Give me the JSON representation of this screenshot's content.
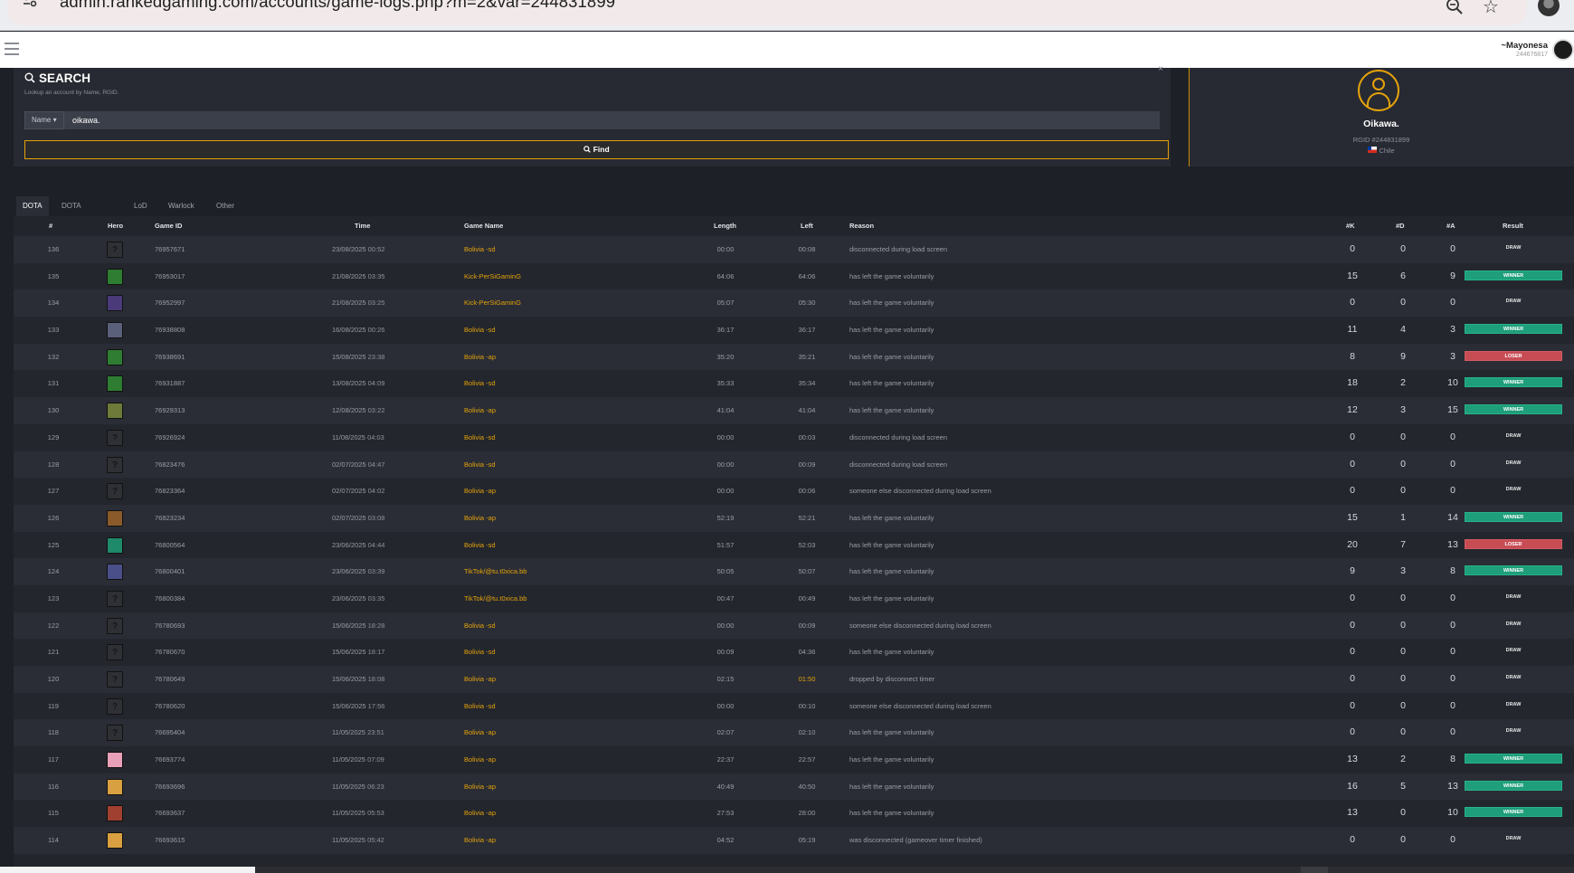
{
  "browser": {
    "url": "admin.rankedgaming.com/accounts/game-logs.php?m=2&var=244831899"
  },
  "header": {
    "user_name": "~Mayonesa",
    "user_id": "244676817"
  },
  "search": {
    "title": "SEARCH",
    "subtitle": "Lookup an account by Name, RGID.",
    "field_select": "Name ▾",
    "query": "oikawa.",
    "find_label": "Find"
  },
  "profile": {
    "name": "Oikawa.",
    "rgid": "RGID #244831899",
    "country": "Chile"
  },
  "tabs": [
    {
      "label": "DOTA",
      "active": true
    },
    {
      "label": "DOTA Dynamic",
      "active": false
    },
    {
      "label": "LoD",
      "active": false
    },
    {
      "label": "Warlock",
      "active": false
    },
    {
      "label": "Other",
      "active": false
    }
  ],
  "table": {
    "headers": {
      "num": "#",
      "hero": "Hero",
      "game_id": "Game ID",
      "time": "Time",
      "game_name": "Game Name",
      "length": "Length",
      "left": "Left",
      "reason": "Reason",
      "k": "#K",
      "d": "#D",
      "a": "#A",
      "result": "Result"
    },
    "rows": [
      {
        "num": "136",
        "hero": "unknown",
        "game_id": "76957671",
        "date": "23/08/2025",
        "clock": "00:52",
        "game_name": "Bolivia -sd",
        "length": "00:00",
        "left": "00:08",
        "reason": "disconnected during load screen",
        "k": "0",
        "d": "0",
        "a": "0",
        "result": "DRAW"
      },
      {
        "num": "135",
        "hero": "#2e7d32",
        "game_id": "76953017",
        "date": "21/08/2025",
        "clock": "03:35",
        "game_name": "Kick-PerSiGaminG",
        "length": "64:06",
        "left": "64:06",
        "reason": "has left the game voluntarily",
        "k": "15",
        "d": "6",
        "a": "9",
        "result": "WINNER"
      },
      {
        "num": "134",
        "hero": "#4a3a7a",
        "game_id": "76952997",
        "date": "21/08/2025",
        "clock": "03:25",
        "game_name": "Kick-PerSiGaminG",
        "length": "05:07",
        "left": "05:30",
        "reason": "has left the game voluntarily",
        "k": "0",
        "d": "0",
        "a": "0",
        "result": "DRAW"
      },
      {
        "num": "133",
        "hero": "#5a5f7a",
        "game_id": "76938808",
        "date": "16/08/2025",
        "clock": "00:26",
        "game_name": "Bolivia -sd",
        "length": "36:17",
        "left": "36:17",
        "reason": "has left the game voluntarily",
        "k": "11",
        "d": "4",
        "a": "3",
        "result": "WINNER"
      },
      {
        "num": "132",
        "hero": "#2e7d32",
        "game_id": "76938691",
        "date": "15/08/2025",
        "clock": "23:38",
        "game_name": "Bolivia -ap",
        "length": "35:20",
        "left": "35:21",
        "reason": "has left the game voluntarily",
        "k": "8",
        "d": "9",
        "a": "3",
        "result": "LOSER"
      },
      {
        "num": "131",
        "hero": "#2e7d32",
        "game_id": "76931887",
        "date": "13/08/2025",
        "clock": "04:09",
        "game_name": "Bolivia -sd",
        "length": "35:33",
        "left": "35:34",
        "reason": "has left the game voluntarily",
        "k": "18",
        "d": "2",
        "a": "10",
        "result": "WINNER"
      },
      {
        "num": "130",
        "hero": "#6d7a3a",
        "game_id": "76929313",
        "date": "12/08/2025",
        "clock": "03:22",
        "game_name": "Bolivia -ap",
        "length": "41:04",
        "left": "41:04",
        "reason": "has left the game voluntarily",
        "k": "12",
        "d": "3",
        "a": "15",
        "result": "WINNER"
      },
      {
        "num": "129",
        "hero": "unknown",
        "game_id": "76926924",
        "date": "11/08/2025",
        "clock": "04:03",
        "game_name": "Bolivia -sd",
        "length": "00:00",
        "left": "00:03",
        "reason": "disconnected during load screen",
        "k": "0",
        "d": "0",
        "a": "0",
        "result": "DRAW"
      },
      {
        "num": "128",
        "hero": "unknown",
        "game_id": "76823476",
        "date": "02/07/2025",
        "clock": "04:47",
        "game_name": "Bolivia -sd",
        "length": "00:00",
        "left": "00:09",
        "reason": "disconnected during load screen",
        "k": "0",
        "d": "0",
        "a": "0",
        "result": "DRAW"
      },
      {
        "num": "127",
        "hero": "unknown",
        "game_id": "76823364",
        "date": "02/07/2025",
        "clock": "04:02",
        "game_name": "Bolivia -ap",
        "length": "00:00",
        "left": "00:06",
        "reason": "someone else disconnected during load screen",
        "k": "0",
        "d": "0",
        "a": "0",
        "result": "DRAW"
      },
      {
        "num": "126",
        "hero": "#8a5a2a",
        "game_id": "76823234",
        "date": "02/07/2025",
        "clock": "03:08",
        "game_name": "Bolivia -ap",
        "length": "52:19",
        "left": "52:21",
        "reason": "has left the game voluntarily",
        "k": "15",
        "d": "1",
        "a": "14",
        "result": "WINNER"
      },
      {
        "num": "125",
        "hero": "#1f8a6a",
        "game_id": "76800564",
        "date": "23/06/2025",
        "clock": "04:44",
        "game_name": "Bolivia -sd",
        "length": "51:57",
        "left": "52:03",
        "reason": "has left the game voluntarily",
        "k": "20",
        "d": "7",
        "a": "13",
        "result": "LOSER"
      },
      {
        "num": "124",
        "hero": "#4a4f8a",
        "game_id": "76800401",
        "date": "23/06/2025",
        "clock": "03:39",
        "game_name": "TikTok/@tu.t0xica.bb",
        "length": "50:05",
        "left": "50:07",
        "reason": "has left the game voluntarily",
        "k": "9",
        "d": "3",
        "a": "8",
        "result": "WINNER"
      },
      {
        "num": "123",
        "hero": "unknown",
        "game_id": "76800384",
        "date": "23/06/2025",
        "clock": "03:35",
        "game_name": "TikTok/@tu.t0xica.bb",
        "length": "00:47",
        "left": "00:49",
        "reason": "has left the game voluntarily",
        "k": "0",
        "d": "0",
        "a": "0",
        "result": "DRAW"
      },
      {
        "num": "122",
        "hero": "unknown",
        "game_id": "76780693",
        "date": "15/06/2025",
        "clock": "18:28",
        "game_name": "Bolivia -sd",
        "length": "00:00",
        "left": "00:09",
        "reason": "someone else disconnected during load screen",
        "k": "0",
        "d": "0",
        "a": "0",
        "result": "DRAW"
      },
      {
        "num": "121",
        "hero": "unknown",
        "game_id": "76780670",
        "date": "15/06/2025",
        "clock": "18:17",
        "game_name": "Bolivia -sd",
        "length": "00:09",
        "left": "04:36",
        "reason": "has left the game voluntarily",
        "k": "0",
        "d": "0",
        "a": "0",
        "result": "DRAW"
      },
      {
        "num": "120",
        "hero": "unknown",
        "game_id": "76780649",
        "date": "15/06/2025",
        "clock": "18:08",
        "game_name": "Bolivia -ap",
        "length": "02:15",
        "left": "01:50",
        "left_alert": true,
        "reason": "dropped by disconnect timer",
        "k": "0",
        "d": "0",
        "a": "0",
        "result": "DRAW"
      },
      {
        "num": "119",
        "hero": "unknown",
        "game_id": "76780620",
        "date": "15/06/2025",
        "clock": "17:56",
        "game_name": "Bolivia -sd",
        "length": "00:00",
        "left": "00:10",
        "reason": "someone else disconnected during load screen",
        "k": "0",
        "d": "0",
        "a": "0",
        "result": "DRAW"
      },
      {
        "num": "118",
        "hero": "unknown",
        "game_id": "76695404",
        "date": "11/05/2025",
        "clock": "23:51",
        "game_name": "Bolivia -ap",
        "length": "02:07",
        "left": "02:10",
        "reason": "has left the game voluntarily",
        "k": "0",
        "d": "0",
        "a": "0",
        "result": "DRAW"
      },
      {
        "num": "117",
        "hero": "#e8a0b8",
        "game_id": "76693774",
        "date": "11/05/2025",
        "clock": "07:09",
        "game_name": "Bolivia -ap",
        "length": "22:37",
        "left": "22:57",
        "reason": "has left the game voluntarily",
        "k": "13",
        "d": "2",
        "a": "8",
        "result": "WINNER"
      },
      {
        "num": "116",
        "hero": "#d8a040",
        "game_id": "76693696",
        "date": "11/05/2025",
        "clock": "06:23",
        "game_name": "Bolivia -ap",
        "length": "40:49",
        "left": "40:50",
        "reason": "has left the game voluntarily",
        "k": "16",
        "d": "5",
        "a": "13",
        "result": "WINNER"
      },
      {
        "num": "115",
        "hero": "#a04030",
        "game_id": "76693637",
        "date": "11/05/2025",
        "clock": "05:53",
        "game_name": "Bolivia -ap",
        "length": "27:53",
        "left": "28:00",
        "reason": "has left the game voluntarily",
        "k": "13",
        "d": "0",
        "a": "10",
        "result": "WINNER"
      },
      {
        "num": "114",
        "hero": "#d8a040",
        "game_id": "76693615",
        "date": "11/05/2025",
        "clock": "05:42",
        "game_name": "Bolivia -ap",
        "length": "04:52",
        "left": "05:19",
        "reason": "was disconnected (gameover timer finished)",
        "k": "0",
        "d": "0",
        "a": "0",
        "result": "DRAW"
      }
    ]
  }
}
